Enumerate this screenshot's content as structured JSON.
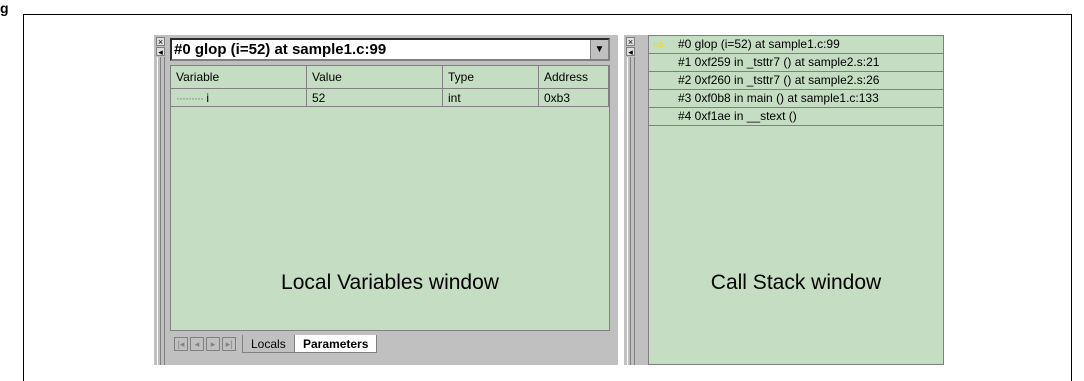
{
  "figure": {
    "label": "g"
  },
  "locals_window": {
    "frame_selector": "#0  glop (i=52) at sample1.c:99",
    "columns": [
      "Variable",
      "Value",
      "Type",
      "Address"
    ],
    "rows": [
      {
        "variable": "i",
        "value": "52",
        "type": "int",
        "address": "0xb3"
      }
    ],
    "caption": "Local Variables window",
    "tabs": [
      "Locals",
      "Parameters"
    ],
    "active_tab": "Parameters"
  },
  "callstack_window": {
    "frames": [
      "#0  glop (i=52) at sample1.c:99",
      "#1  0xf259 in _tsttr7 () at sample2.s:21",
      "#2  0xf260 in _tsttr7 () at sample2.s:26",
      "#3  0xf0b8 in main () at sample1.c:133",
      "#4  0xf1ae in __stext ()"
    ],
    "caption": "Call Stack window"
  },
  "colors": {
    "pane_bg": "#c5ddc2",
    "chrome": "#c0c0c0",
    "current_frame_arrow": "#f0e000"
  }
}
